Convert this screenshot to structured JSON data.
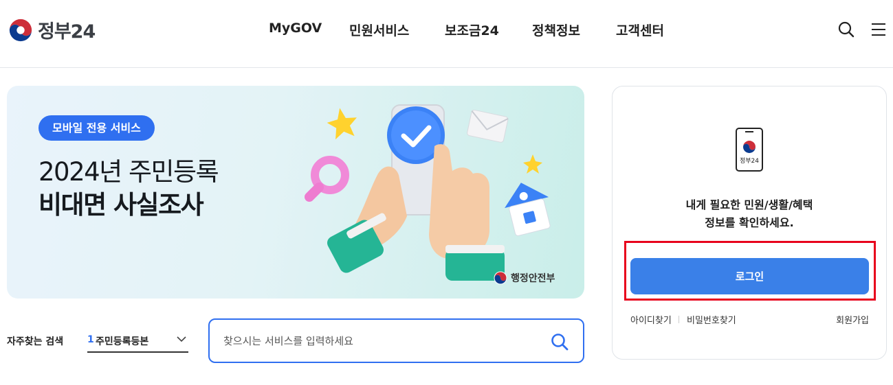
{
  "header": {
    "logo_text": "정부24",
    "nav": [
      "MyGOV",
      "민원서비스",
      "보조금24",
      "정책정보",
      "고객센터"
    ],
    "search_icon": "search-icon",
    "menu_icon": "hamburger-menu-icon"
  },
  "banner": {
    "badge": "모바일 전용 서비스",
    "title_line1": "2024년 주민등록",
    "title_line2": "비대면 사실조사",
    "ministry": "행정안전부"
  },
  "frequent_search": {
    "label": "자주찾는 검색",
    "selected_number": "1",
    "selected_text": "주민등록등본"
  },
  "search": {
    "placeholder": "찾으시는 서비스를 입력하세요"
  },
  "login_card": {
    "phone_logo_text": "정부24",
    "message_line1": "내게 필요한 민원/생활/혜택",
    "message_line2": "정보를 확인하세요.",
    "login_label": "로그인",
    "find_id": "아이디찾기",
    "find_password": "비밀번호찾기",
    "signup": "회원가입"
  },
  "colors": {
    "primary": "#2f6ff0",
    "login_button": "#3a80e8",
    "highlight": "#e8001c"
  }
}
